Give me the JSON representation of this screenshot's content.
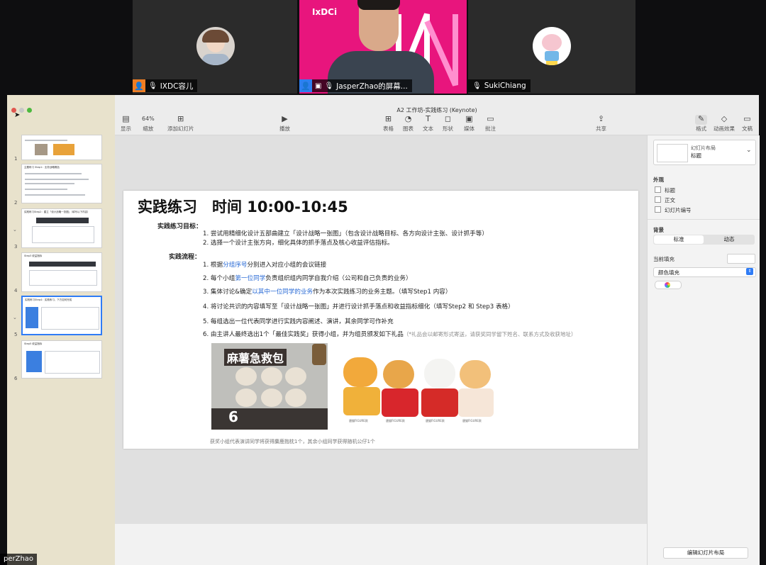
{
  "meeting": {
    "participants": [
      {
        "name": "IXDC容儿"
      },
      {
        "name": "JasperZhao的屏幕..."
      },
      {
        "name": "SukiChiang"
      }
    ],
    "poster_text": "IxDCi",
    "bottom_name": "perZhao"
  },
  "window": {
    "title": "A2 工作坊-实践练习 (Keynote)"
  },
  "toolbar": {
    "show": "显示",
    "zoom_value": "64%",
    "zoom": "缩放",
    "add_slide": "添加幻灯片",
    "play": "播放",
    "table": "表格",
    "chart": "图表",
    "text": "文本",
    "shape": "形状",
    "media": "媒体",
    "comment": "批注",
    "share": "共享",
    "format": "格式",
    "animate": "动画效果",
    "document": "文稿"
  },
  "sidebar": {
    "slide_numbers": [
      "1",
      "2",
      "3",
      "4",
      "5",
      "6"
    ],
    "thumb_titles": [
      "",
      "主题练习 Step1：业务战略概括",
      "实践练习Step2：建立「设计战略一张图」（填写以下内容）",
      "Step3 收益指标",
      "实践练习Step4：实践练习，下方如何完成",
      "Step5 收益指标"
    ]
  },
  "slide": {
    "title": "实践练习　时间 10:00-10:45",
    "goal_label": "实践练习目标：",
    "goals": [
      "1. 尝试用精细化设计五部曲建立「设计战略一张图」（包含设计战略目标、各方向设计主张、设计抓手等）",
      "2. 选择一个设计主张方向，细化具体的抓手落点及核心收益评估指标。"
    ],
    "process_label": "实践流程：",
    "steps": [
      {
        "a": "1. 根据",
        "b": "分组序号",
        "c": "分别进入对应小组的会议链接"
      },
      {
        "a": "2. 每个小组",
        "b": "第一位同学",
        "c": "负责组织组内同学自我介绍（公司和自己负责的业务）"
      },
      {
        "a": "3. 集体讨论&确定",
        "b": "以其中一位同学的业务",
        "c": "作为本次实践练习的业务主题。（填写Step1 内容）"
      },
      {
        "a": "4. 将讨论共识的内容填写至「设计战略一张图」并进行设计抓手落点和收益指标细化（填写Step2 和 Step3 表格）",
        "b": "",
        "c": ""
      },
      {
        "a": "5. 每组选出一位代表同学进行实践内容阐述、演讲，其余同学可作补充",
        "b": "",
        "c": ""
      },
      {
        "a": "6. 由主讲人最终选出1个「最佳实践奖」获得小组，并为组员颁发如下礼品",
        "b": "",
        "c": "（*礼品会以邮寄形式寄送，请获奖同学留下姓名、联系方式及收获地址）"
      }
    ],
    "package_text": "麻薯急救包",
    "package_number": "6",
    "figure_labels": [
      "唐猫FIGURE款",
      "唐猫FIGURE款",
      "唐猫FIGURE款",
      "唐猫FIGURE款"
    ],
    "caption": "获奖小组代表演讲同学将获得麋鹿抱枕1个，其余小组同学获得随机公仔1个"
  },
  "inspector": {
    "layout_caption": "幻灯片布局",
    "layout_name": "标题",
    "appearance": "外观",
    "opt_title": "标题",
    "opt_body": "正文",
    "opt_number": "幻灯片编号",
    "background": "背景",
    "tab_standard": "标准",
    "tab_dynamic": "动态",
    "current_fill": "当前填充",
    "fill_type": "颜色填充",
    "edit_layout": "编辑幻灯片布局"
  },
  "colors": {
    "pink_poster": "#e8157d",
    "link_blue": "#2a6bd6",
    "sidebar_bg": "#e8e2cc",
    "selected_thumb": "#2f7cf6"
  }
}
